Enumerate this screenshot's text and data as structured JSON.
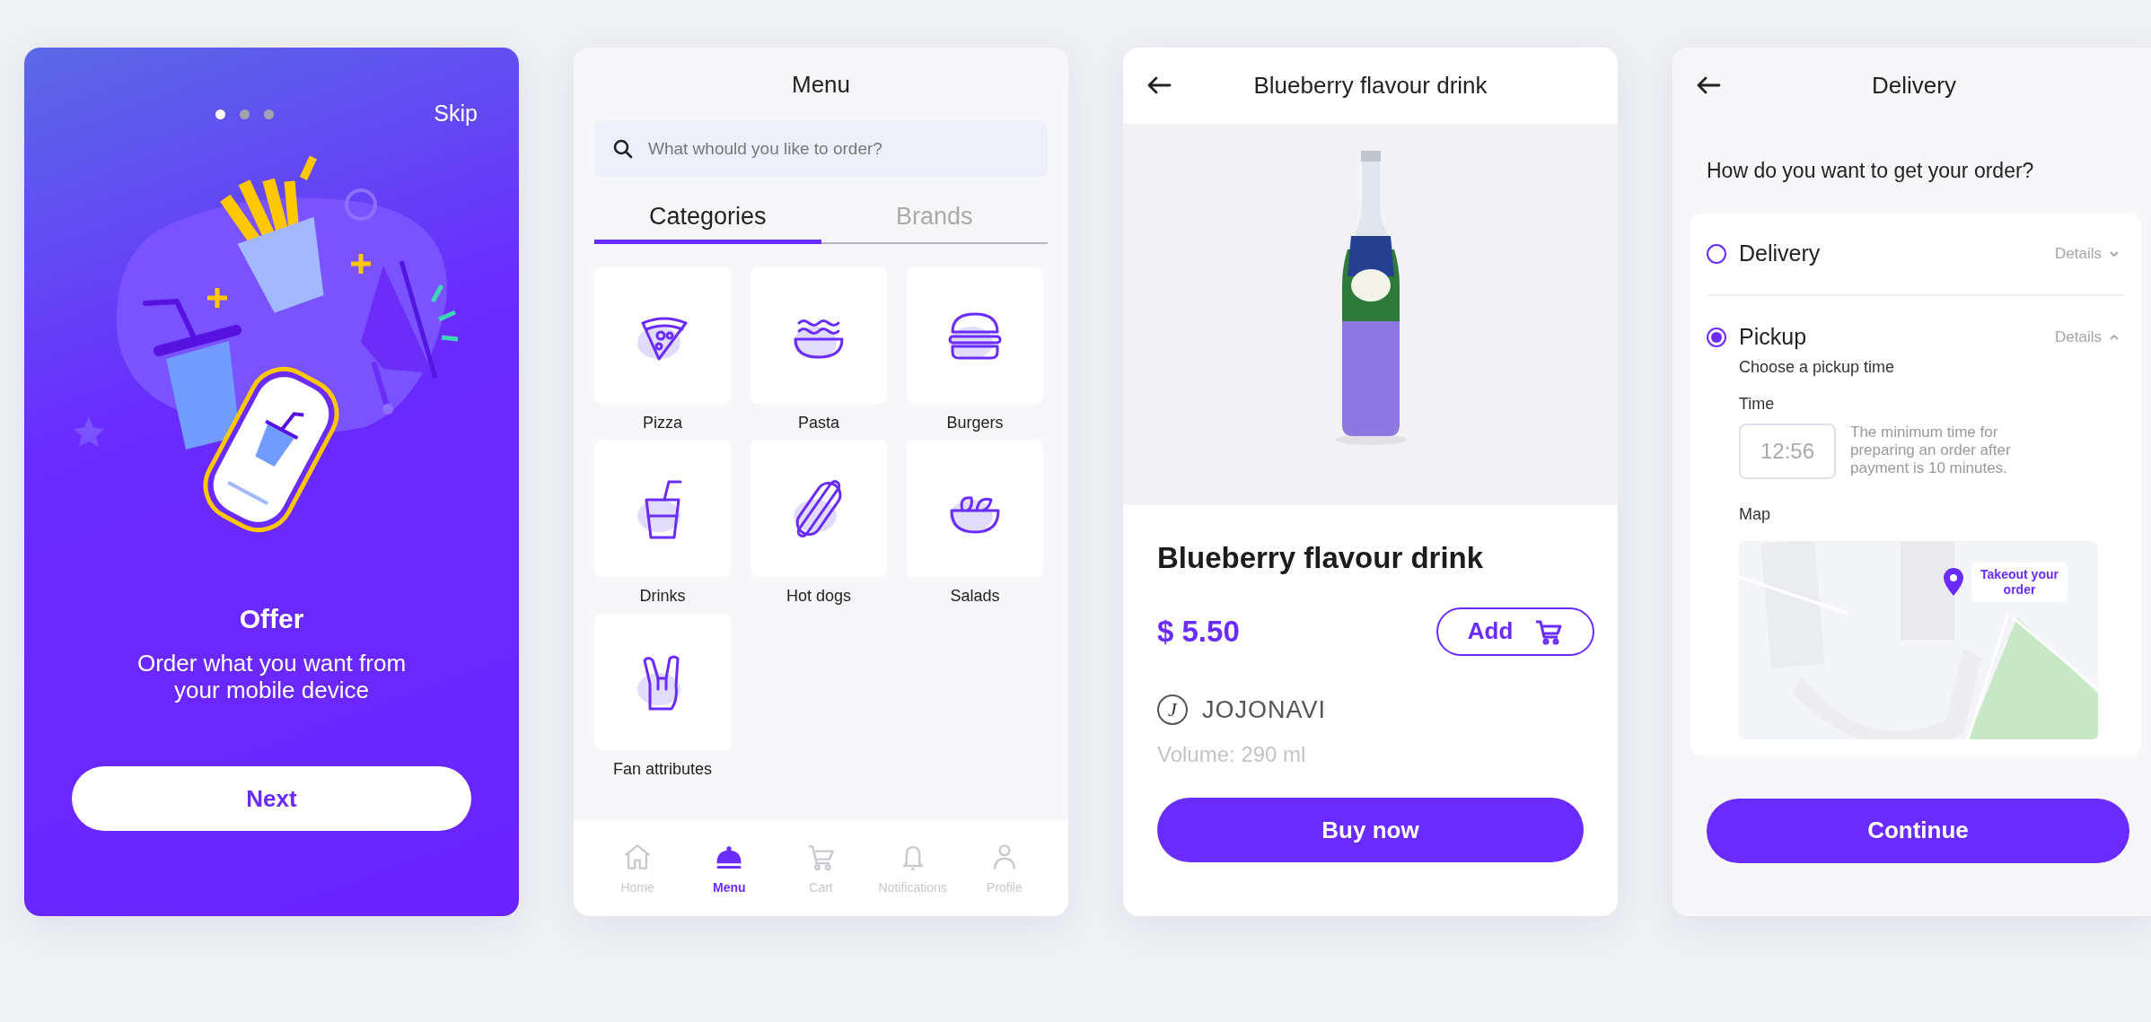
{
  "onboarding": {
    "pager": [
      {
        "selected": true
      },
      {
        "selected": false
      },
      {
        "selected": false
      }
    ],
    "skip": "Skip",
    "title": "Offer",
    "subtitle": "Order what you want from your mobile device",
    "button": "Next"
  },
  "menu_screen": {
    "title": "Menu",
    "search": {
      "placeholder": "What whould you like to order?"
    },
    "tabs": [
      {
        "label": "Categories",
        "selected": true
      },
      {
        "label": "Brands",
        "selected": false
      }
    ],
    "categories": [
      {
        "label": "Pizza",
        "kind": "pizza"
      },
      {
        "label": "Pasta",
        "kind": "pasta"
      },
      {
        "label": "Burgers",
        "kind": "burger"
      },
      {
        "label": "Drinks",
        "kind": "drink"
      },
      {
        "label": "Hot dogs",
        "kind": "hotdog"
      },
      {
        "label": "Salads",
        "kind": "salad"
      },
      {
        "label": "Fan attributes",
        "kind": "hand"
      }
    ],
    "nav": [
      {
        "label": "Home",
        "kind": "home",
        "selected": false
      },
      {
        "label": "Menu",
        "kind": "cloche",
        "selected": true
      },
      {
        "label": "Cart",
        "kind": "cart",
        "selected": false
      },
      {
        "label": "Notifications",
        "kind": "bell",
        "selected": false
      },
      {
        "label": "Profile",
        "kind": "person",
        "selected": false
      }
    ]
  },
  "product_screen": {
    "title": "Blueberry flavour drink",
    "name": "Blueberry flavour drink",
    "price": "$ 5.50",
    "add_button": "Add",
    "brand_logo": "J",
    "brand": "JOJONAVI",
    "volume": "Volume: 290 ml",
    "buy_button": "Buy now"
  },
  "delivery_screen": {
    "title": "Delivery",
    "question": "How do you want to get your order?",
    "options": [
      {
        "label": "Delivery",
        "details": "Details",
        "selected": false,
        "expanded": false
      },
      {
        "label": "Pickup",
        "details": "Details",
        "selected": true,
        "expanded": true
      }
    ],
    "pickup_heading": "Choose a pickup time",
    "time_label": "Time",
    "time_value": "12:56",
    "time_note": "The minimum time for preparing an order after payment is 10 minutes.",
    "map_label": "Map",
    "map_callout": "Takeout your order",
    "button": "Continue"
  }
}
